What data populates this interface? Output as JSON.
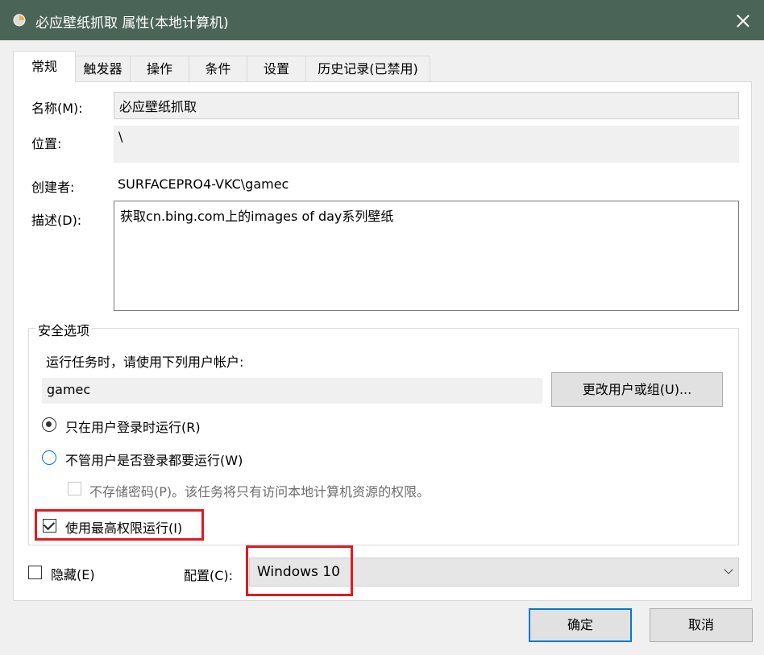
{
  "window": {
    "title": "必应壁纸抓取 属性(本地计算机)",
    "icon": "task-scheduler-clock-icon"
  },
  "tabs": [
    {
      "label": "常规",
      "active": true
    },
    {
      "label": "触发器",
      "active": false
    },
    {
      "label": "操作",
      "active": false
    },
    {
      "label": "条件",
      "active": false
    },
    {
      "label": "设置",
      "active": false
    },
    {
      "label": "历史记录(已禁用)",
      "active": false
    }
  ],
  "general": {
    "name_label": "名称(M):",
    "name_value": "必应壁纸抓取",
    "location_label": "位置:",
    "location_value": "\\",
    "author_label": "创建者:",
    "author_value": "SURFACEPRO4-VKC\\gamec",
    "description_label": "描述(D):",
    "description_value": "获取cn.bing.com上的images of day系列壁纸"
  },
  "security": {
    "group_title": "安全选项",
    "run_as_prompt": "运行任务时，请使用下列用户帐户:",
    "user_account": "gamec",
    "change_user_button": "更改用户或组(U)...",
    "radio_logged_on": {
      "label": "只在用户登录时运行(R)",
      "checked": true
    },
    "radio_whether_logged": {
      "label": "不管用户是否登录都要运行(W)",
      "checked": false
    },
    "do_not_store_password": {
      "label": "不存储密码(P)。该任务将只有访问本地计算机资源的权限。",
      "checked": false,
      "enabled": false
    },
    "highest_privileges": {
      "label": "使用最高权限运行(I)",
      "checked": true
    }
  },
  "bottom": {
    "hidden": {
      "label": "隐藏(E)",
      "checked": false
    },
    "configure_label": "配置(C):",
    "configure_value": "Windows 10"
  },
  "buttons": {
    "ok": "确定",
    "cancel": "取消"
  },
  "colors": {
    "titlebar": "#4b6458",
    "highlight": "#e01a22",
    "focus": "#0078d7"
  }
}
